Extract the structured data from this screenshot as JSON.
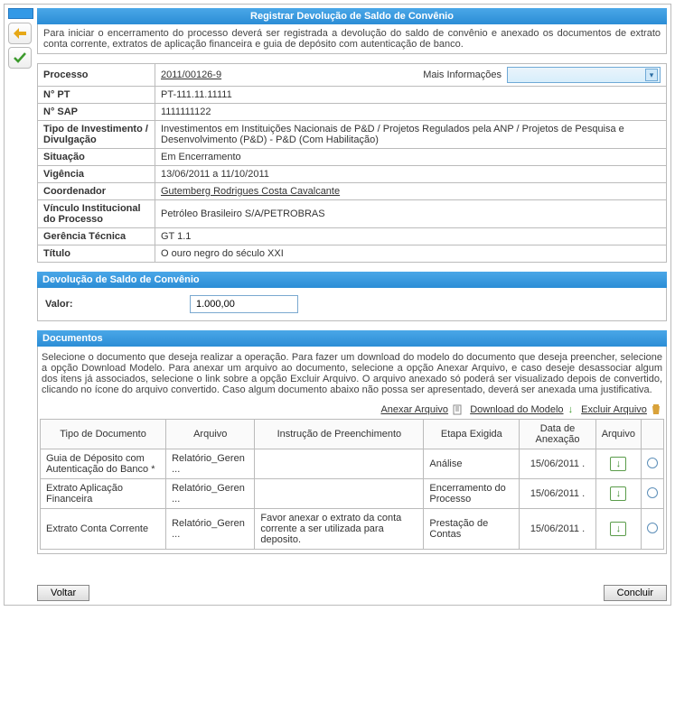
{
  "title": "Registrar Devolução de Saldo de Convênio",
  "intro": "Para iniciar o encerramento do processo deverá ser registrada a devolução do saldo de convênio e anexado os documentos de extrato conta corrente, extratos de aplicação financeira e guia de depósito com autenticação de banco.",
  "mais_info_label": "Mais Informações",
  "info": {
    "processo_label": "Processo",
    "processo_value": "2011/00126-9",
    "npt_label": "N° PT",
    "npt_value": "PT-111.11.11111",
    "nsap_label": "N° SAP",
    "nsap_value": "1111111122",
    "tipo_label": "Tipo de Investimento / Divulgação",
    "tipo_value": "Investimentos em Instituições Nacionais de P&D / Projetos Regulados pela ANP / Projetos de Pesquisa e Desenvolvimento (P&D) - P&D (Com Habilitação)",
    "situacao_label": "Situação",
    "situacao_value": "Em Encerramento",
    "vigencia_label": "Vigência",
    "vigencia_value": "13/06/2011 a 11/10/2011",
    "coord_label": "Coordenador",
    "coord_value": "Gutemberg Rodrigues Costa Cavalcante",
    "vinculo_label": "Vínculo Institucional do Processo",
    "vinculo_value": "Petróleo Brasileiro S/A/PETROBRAS",
    "gerencia_label": "Gerência Técnica",
    "gerencia_value": "GT 1.1",
    "titulo_label": "Título",
    "titulo_value": "O ouro negro do século XXI"
  },
  "devolucao": {
    "head": "Devolução de Saldo de Convênio",
    "valor_label": "Valor:",
    "valor_value": "1.000,00"
  },
  "documentos": {
    "head": "Documentos",
    "text": "Selecione o documento que deseja realizar a operação. Para fazer um download do modelo do documento que deseja preencher, selecione a opção Download Modelo. Para anexar um arquivo ao documento, selecione a opção Anexar Arquivo, e caso deseje desassociar algum dos itens já associados, selecione o link sobre a opção Excluir Arquivo. O arquivo anexado só poderá ser visualizado depois de convertido, clicando no ícone do arquivo convertido. Caso algum documento abaixo não possa ser apresentado, deverá ser anexada uma justificativa.",
    "link_anexar": "Anexar Arquivo",
    "link_download": "Download do Modelo",
    "link_excluir": "Excluir Arquivo",
    "headers": {
      "tipo": "Tipo de Documento",
      "arquivo": "Arquivo",
      "instrucao": "Instrução de Preenchimento",
      "etapa": "Etapa Exigida",
      "data": "Data de Anexação",
      "arq2": "Arquivo"
    },
    "rows": [
      {
        "tipo": "Guia de Déposito com Autenticação do Banco *",
        "arquivo": "Relatório_Geren ...",
        "instrucao": "",
        "etapa": "Análise",
        "data": "15/06/2011"
      },
      {
        "tipo": "Extrato Aplicação Financeira",
        "arquivo": "Relatório_Geren ...",
        "instrucao": "",
        "etapa": "Encerramento do Processo",
        "data": "15/06/2011"
      },
      {
        "tipo": "Extrato Conta Corrente",
        "arquivo": "Relatório_Geren ...",
        "instrucao": "Favor anexar o extrato da conta corrente a ser utilizada para deposito.",
        "etapa": "Prestação de Contas",
        "data": "15/06/2011"
      }
    ]
  },
  "buttons": {
    "voltar": "Voltar",
    "concluir": "Concluir"
  }
}
